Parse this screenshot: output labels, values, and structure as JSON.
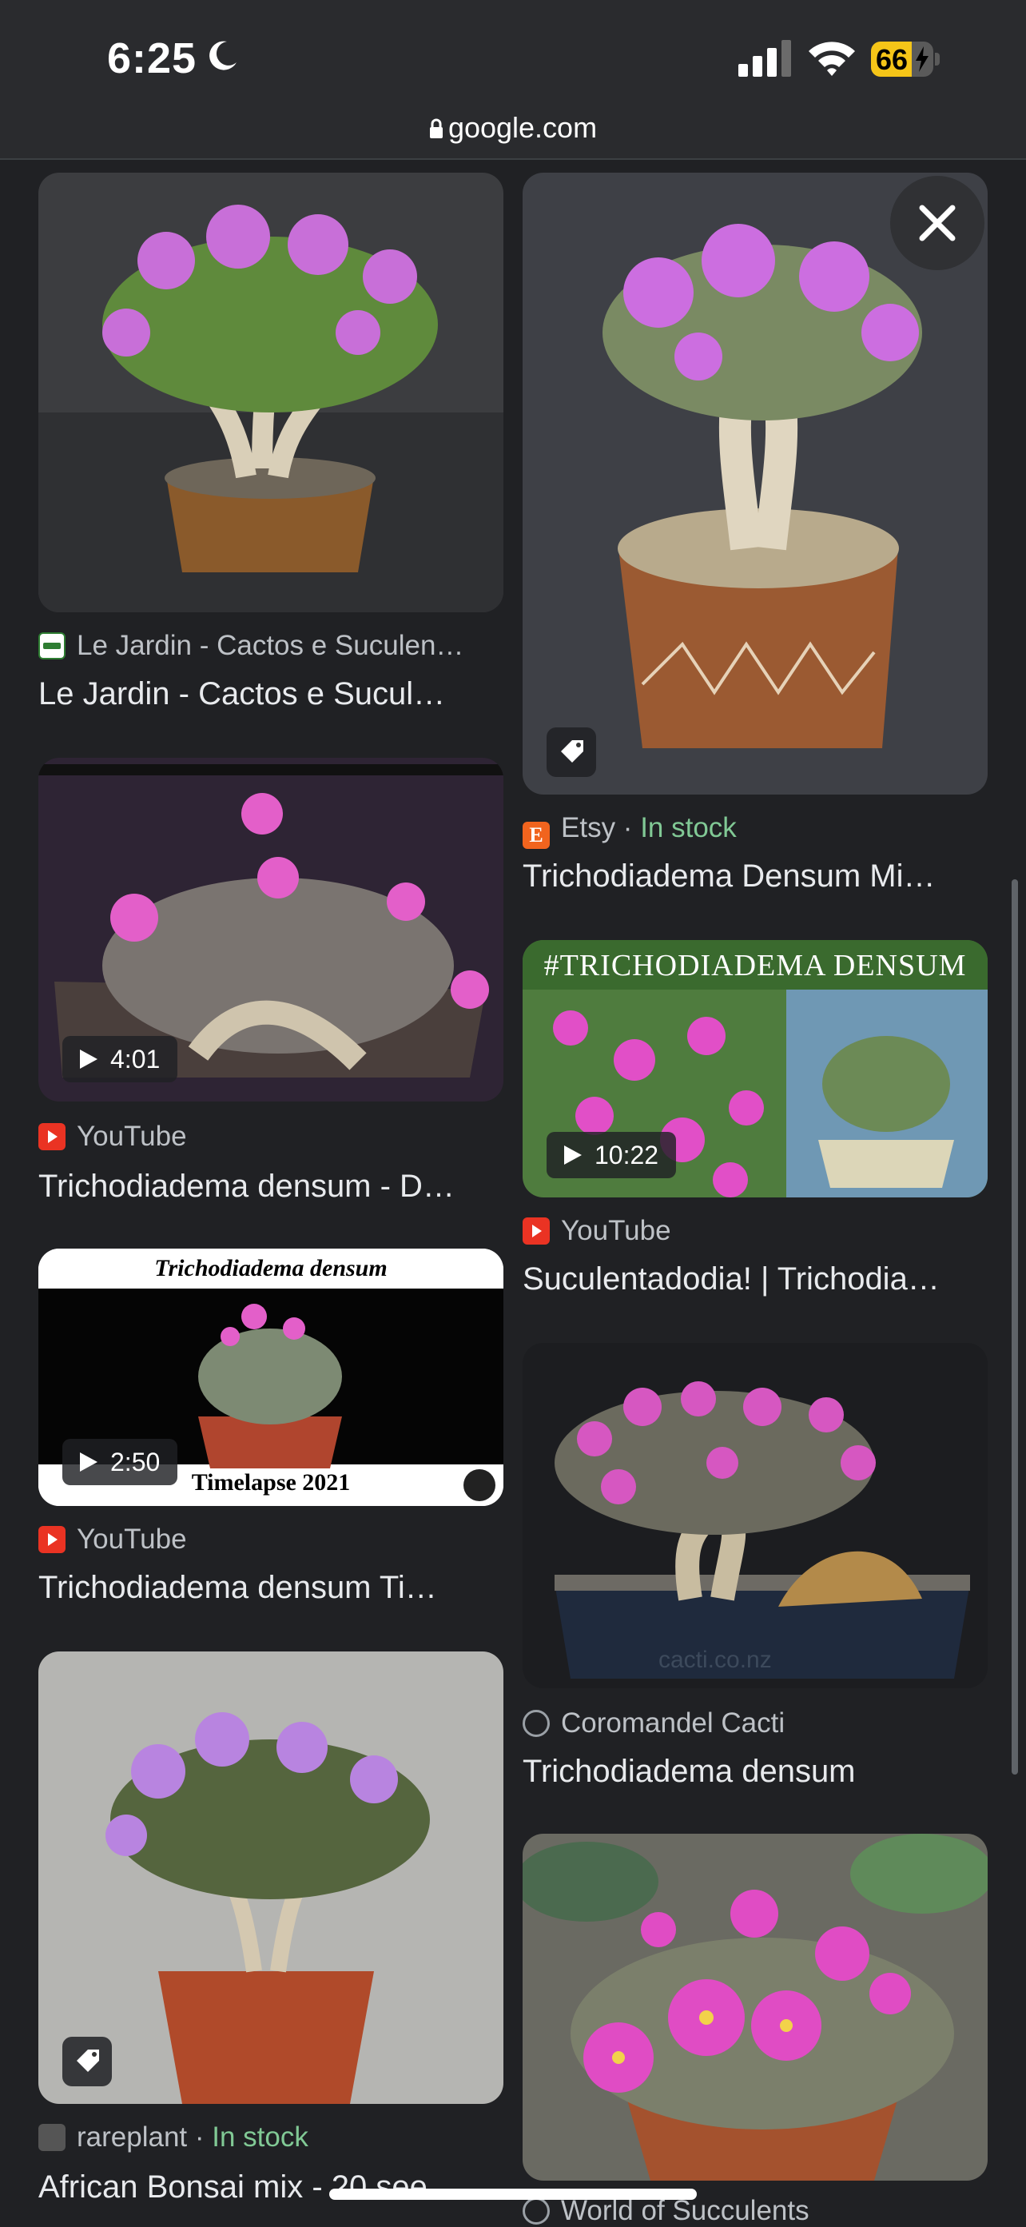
{
  "status": {
    "time": "6:25",
    "battery_level": "66",
    "battery_fraction": 0.66
  },
  "browser": {
    "url": "google.com"
  },
  "colors": {
    "background": "#202124",
    "in_stock": "#81c995",
    "youtube": "#ea3323",
    "etsy": "#f1641e"
  },
  "results": [
    {
      "source": "Le Jardin - Cactos e Suculen…",
      "title": "Le Jardin - Cactos e Sucul…"
    },
    {
      "source": "YouTube",
      "title": "Trichodiadema densum - D…",
      "duration": "4:01"
    },
    {
      "source": "YouTube",
      "title": "Trichodiadema densum Ti…",
      "duration": "2:50",
      "image_text_top": "Trichodiadema densum",
      "image_text_bottom": "Timelapse 2021"
    },
    {
      "source": "rareplant",
      "stock": "In stock",
      "title": "African Bonsai mix - 20 see…"
    },
    {
      "source": "Etsy",
      "stock": "In stock",
      "title": "Trichodiadema Densum Mi…"
    },
    {
      "source": "YouTube",
      "title": "Suculentadodia! | Trichodia…",
      "duration": "10:22",
      "image_text_top": "#TRICHODIADEMA DENSUM"
    },
    {
      "source": "Coromandel Cacti",
      "title": "Trichodiadema densum",
      "image_watermark": "cacti.co.nz"
    },
    {
      "source": "World of Succulents",
      "title": ""
    }
  ],
  "separator": " · ",
  "icons": [
    "moon-icon",
    "signal-icon",
    "wifi-icon",
    "battery-icon",
    "lock-icon",
    "close-icon",
    "play-icon",
    "tag-icon",
    "youtube-icon",
    "etsy-icon",
    "globe-icon"
  ]
}
